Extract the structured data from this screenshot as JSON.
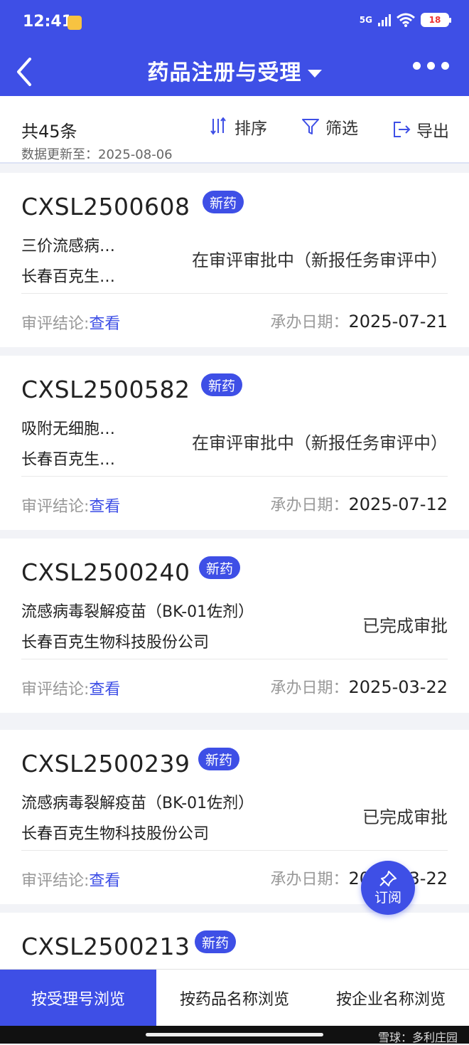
{
  "status_bar": {
    "time": "12:41",
    "network": "5G",
    "battery": "18"
  },
  "nav": {
    "title": "药品注册与受理",
    "icons": [
      "back-arrow-icon",
      "caret-down-icon",
      "more-dots-icon"
    ]
  },
  "toolbar": {
    "count": "共45条",
    "updated": "数据更新至：2025-08-06",
    "sort_label": "排序",
    "filter_label": "筛选",
    "export_label": "导出"
  },
  "cards": [
    {
      "code": "CXSL2500608",
      "badge": "新药",
      "drug": "三价流感病…",
      "company": "长春百克生…",
      "status": "在审评审批中（新报任务审评中）",
      "conclusion_label": "审评结论:",
      "conclusion_link": "查看",
      "date_label": "承办日期：",
      "date": "2025-07-21"
    },
    {
      "code": "CXSL2500582",
      "badge": "新药",
      "drug": "吸附无细胞…",
      "company": "长春百克生…",
      "status": "在审评审批中（新报任务审评中）",
      "conclusion_label": "审评结论:",
      "conclusion_link": "查看",
      "date_label": "承办日期：",
      "date": "2025-07-12"
    },
    {
      "code": "CXSL2500240",
      "badge": "新药",
      "drug": "流感病毒裂解疫苗（BK-01佐剂）",
      "company": "长春百克生物科技股份公司",
      "status": "已完成审批",
      "conclusion_label": "审评结论:",
      "conclusion_link": "查看",
      "date_label": "承办日期：",
      "date": "2025-03-22"
    },
    {
      "code": "CXSL2500239",
      "badge": "新药",
      "drug": "流感病毒裂解疫苗（BK-01佐剂）",
      "company": "长春百克生物科技股份公司",
      "status": "已完成审批",
      "conclusion_label": "审评结论:",
      "conclusion_link": "查看",
      "date_label": "承办日期：",
      "date": "2025-03-22"
    },
    {
      "code": "CXSL2500213",
      "badge": "新药"
    }
  ],
  "subscribe": {
    "label": "订阅",
    "icon": "pin-icon"
  },
  "bottom_tabs": [
    {
      "label": "按受理号浏览",
      "active": true
    },
    {
      "label": "按药品名称浏览",
      "active": false
    },
    {
      "label": "按企业名称浏览",
      "active": false
    }
  ],
  "watermark": "雪球：多利庄园",
  "colors": {
    "primary": "#3e4fe6",
    "background": "#f2f3f7"
  }
}
